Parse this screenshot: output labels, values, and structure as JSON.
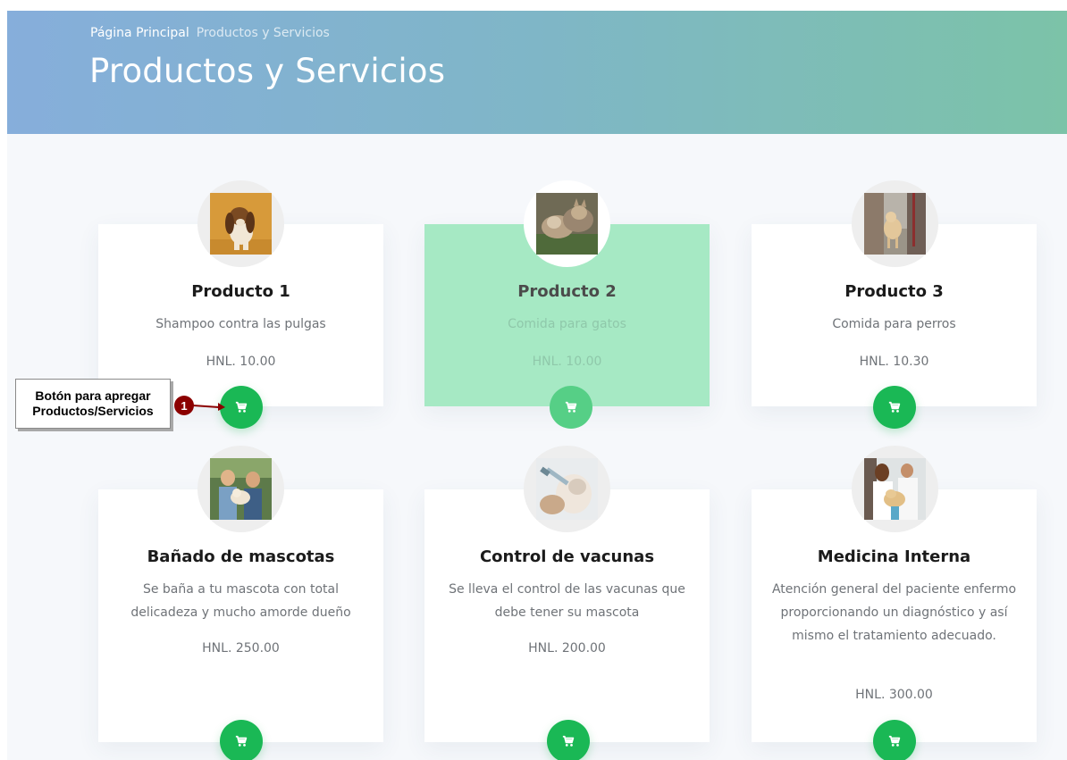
{
  "header": {
    "breadcrumb_home": "Página Principal",
    "breadcrumb_current": "Productos y Servicios",
    "title": "Productos y Servicios"
  },
  "cards": [
    {
      "title": "Producto 1",
      "desc": "Shampoo contra las pulgas",
      "price": "HNL. 10.00",
      "image": "dog-photo"
    },
    {
      "title": "Producto 2",
      "desc": "Comida para gatos",
      "price": "HNL. 10.00",
      "image": "cats-photo"
    },
    {
      "title": "Producto 3",
      "desc": "Comida para perros",
      "price": "HNL. 10.30",
      "image": "dog-walk-photo"
    },
    {
      "title": "Bañado de mascotas",
      "desc": "Se baña a tu mascota con total delicadeza y mucho amorde dueño",
      "price": "HNL. 250.00",
      "image": "pet-family-photo"
    },
    {
      "title": "Control de vacunas",
      "desc": "Se lleva el control de las vacunas que debe tener su mascota",
      "price": "HNL. 200.00",
      "image": "vaccine-photo"
    },
    {
      "title": "Medicina Interna",
      "desc": "Atención general del paciente enfermo proporcionando un diagnóstico y así mismo el tratamiento adecuado.",
      "price": "HNL. 300.00",
      "image": "vet-photo"
    }
  ],
  "annotation": {
    "line1": "Botón para apregar",
    "line2": "Productos/Servicios",
    "badge": "1"
  },
  "colors": {
    "accent": "#1ab855",
    "highlight_card": "#a6e9c4",
    "annotation_badge": "#8b0000"
  },
  "icons": {
    "cart": "shopping-cart-icon"
  }
}
